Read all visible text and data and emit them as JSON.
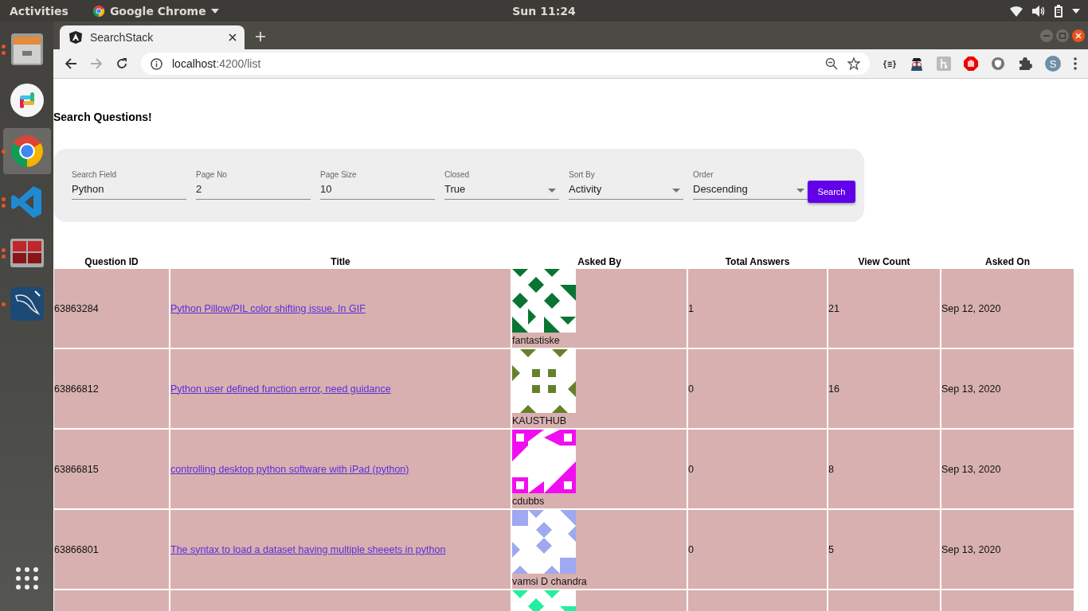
{
  "top_bar": {
    "activities": "Activities",
    "app_menu": "Google Chrome",
    "clock": "Sun 11:24"
  },
  "dock": [
    {
      "kind": "files",
      "running": true,
      "multiple": true,
      "selected": false
    },
    {
      "kind": "slack",
      "running": false,
      "selected": false
    },
    {
      "kind": "chrome",
      "running": true,
      "multiple": false,
      "selected": true
    },
    {
      "kind": "vscode",
      "running": true,
      "multiple": true,
      "selected": false
    },
    {
      "kind": "terminal",
      "running": true,
      "multiple": true,
      "selected": false
    },
    {
      "kind": "mysql",
      "running": true,
      "multiple": false,
      "selected": false
    },
    {
      "kind": "apps",
      "running": false,
      "selected": false
    }
  ],
  "browser": {
    "tab_title": "SearchStack",
    "url_host": "localhost",
    "url_path": ":4200/list",
    "profile_initial": "S",
    "extension_label": "{≡}"
  },
  "page": {
    "heading": "Search Questions!",
    "form": {
      "fields": [
        {
          "kind": "text",
          "label": "Search Field",
          "value": "Python"
        },
        {
          "kind": "text",
          "label": "Page No",
          "value": "2"
        },
        {
          "kind": "text",
          "label": "Page Size",
          "value": "10"
        },
        {
          "kind": "select",
          "label": "Closed",
          "value": "True"
        },
        {
          "kind": "select",
          "label": "Sort By",
          "value": "Activity"
        },
        {
          "kind": "select",
          "label": "Order",
          "value": "Descending"
        }
      ],
      "button": "Search"
    },
    "table": {
      "columns": [
        "Question ID",
        "Title",
        "Asked By",
        "Total Answers",
        "View Count",
        "Asked On"
      ],
      "rows": [
        {
          "id": "63863284",
          "title": "Python Pillow/PIL color shifting issue. In GIF",
          "user": "fantastiske",
          "color": "#087530",
          "answers": "1",
          "views": "21",
          "date": "Sep 12, 2020"
        },
        {
          "id": "63866812",
          "title": "Python user defined function error, need guidance",
          "user": "KAUSTHUB",
          "color": "#66802a",
          "answers": "0",
          "views": "16",
          "date": "Sep 13, 2020"
        },
        {
          "id": "63866815",
          "title": "controlling desktop python software with iPad (python)",
          "user": "cdubbs",
          "color": "#f00ef0",
          "answers": "0",
          "views": "8",
          "date": "Sep 13, 2020"
        },
        {
          "id": "63866801",
          "title": "The syntax to load a dataset having multiple sheeets in python",
          "user": "vamsi D chandra",
          "color": "#9fa8f0",
          "answers": "0",
          "views": "5",
          "date": "Sep 13, 2020"
        },
        {
          "color": "#22f0a0"
        }
      ]
    }
  }
}
